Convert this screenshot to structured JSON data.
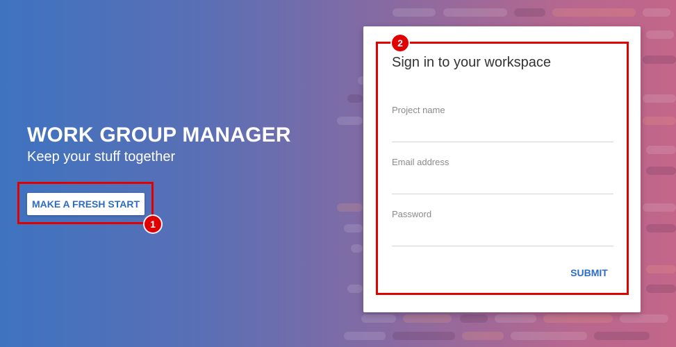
{
  "hero": {
    "title": "WORK GROUP MANAGER",
    "subtitle": "Keep your stuff together",
    "cta_label": "MAKE A FRESH START"
  },
  "annotations": {
    "badge_1": "1",
    "badge_2": "2",
    "highlight_color": "#e00000"
  },
  "signin": {
    "title": "Sign in to your workspace",
    "fields": [
      {
        "label": "Project name",
        "value": ""
      },
      {
        "label": "Email address",
        "value": ""
      },
      {
        "label": "Password",
        "value": ""
      }
    ],
    "submit_label": "SUBMIT"
  },
  "colors": {
    "gradient_start": "#3e73c0",
    "gradient_end": "#c3668a",
    "accent": "#2e6cc4"
  }
}
